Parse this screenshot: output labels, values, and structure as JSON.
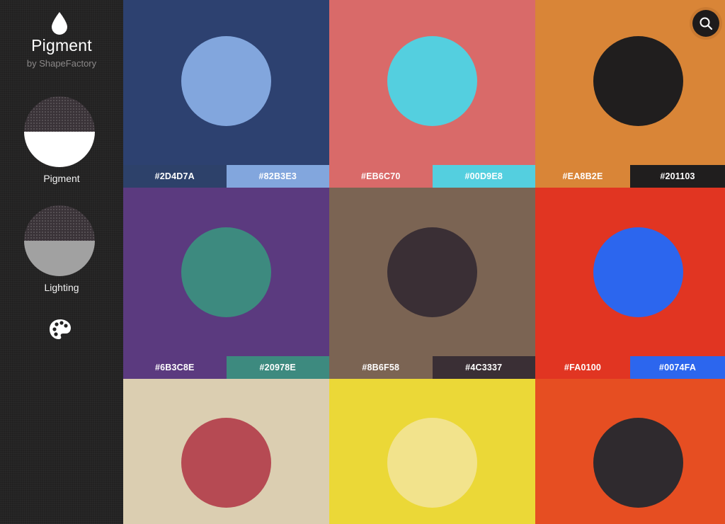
{
  "app": {
    "title": "Pigment",
    "subtitle": "by ShapeFactory"
  },
  "sidebar": {
    "modes": [
      {
        "label": "Pigment",
        "top_color": "#3A3338",
        "bottom_color": "#FFFFFF"
      },
      {
        "label": "Lighting",
        "top_color": "#3A3338",
        "bottom_color": "#A1A1A1"
      }
    ],
    "palette_icon": "palette-icon"
  },
  "search": {
    "icon": "search-icon"
  },
  "tiles": [
    {
      "bg": "#2D4170",
      "circle": "#82A6DD",
      "chips": [
        {
          "label": "#2D4D7A",
          "color": "#2D416A"
        },
        {
          "label": "#82B3E3",
          "color": "#82A6DD"
        }
      ]
    },
    {
      "bg": "#D96A69",
      "circle": "#54CFDF",
      "chips": [
        {
          "label": "#EB6C70",
          "color": "#D96A69"
        },
        {
          "label": "#00D9E8",
          "color": "#54CFDF"
        }
      ]
    },
    {
      "bg": "#D98537",
      "circle": "#201E1E",
      "chips": [
        {
          "label": "#EA8B2E",
          "color": "#D98537"
        },
        {
          "label": "#201103",
          "color": "#201E1E"
        }
      ]
    },
    {
      "bg": "#5B3A7F",
      "circle": "#3D8A7F",
      "chips": [
        {
          "label": "#6B3C8E",
          "color": "#5B3A7F"
        },
        {
          "label": "#20978E",
          "color": "#3D8A7F"
        }
      ]
    },
    {
      "bg": "#7B6453",
      "circle": "#3A2F35",
      "chips": [
        {
          "label": "#8B6F58",
          "color": "#7B6453"
        },
        {
          "label": "#4C3337",
          "color": "#3A2F35"
        }
      ]
    },
    {
      "bg": "#E13522",
      "circle": "#2C66EE",
      "chips": [
        {
          "label": "#FA0100",
          "color": "#E13522"
        },
        {
          "label": "#0074FA",
          "color": "#2C66EE"
        }
      ]
    },
    {
      "bg": "#DBCEB1",
      "circle": "#B64A53",
      "chips": []
    },
    {
      "bg": "#EBD837",
      "circle": "#F2E38C",
      "chips": []
    },
    {
      "bg": "#E64E22",
      "circle": "#2F2A2E",
      "chips": []
    }
  ]
}
